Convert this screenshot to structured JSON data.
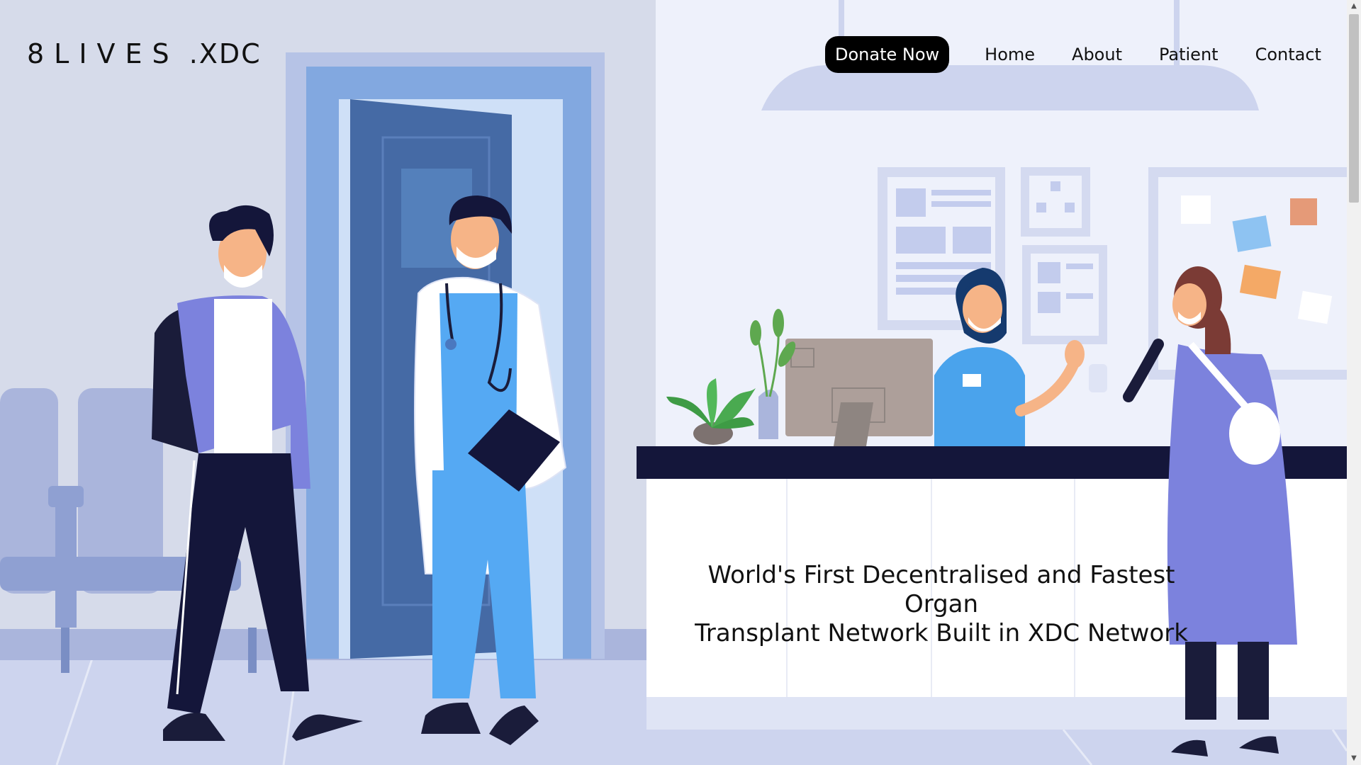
{
  "brand": {
    "logo_part1": "8LIVES",
    "logo_part2": " .XDC"
  },
  "nav": {
    "donate_label": "Donate Now",
    "links": [
      "Home",
      "About",
      "Patient",
      "Contact"
    ]
  },
  "hero": {
    "headline_line1": "World's First Decentralised and Fastest Organ",
    "headline_line2": "Transplant Network Built in XDC Network"
  },
  "scrollbar": {
    "up_icon": "▲",
    "down_icon": "▼"
  }
}
